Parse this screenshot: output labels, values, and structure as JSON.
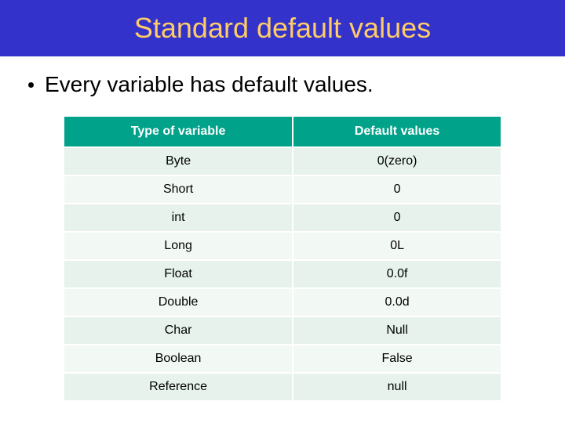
{
  "title": "Standard default values",
  "bullet": "Every variable has default values.",
  "table": {
    "headers": [
      "Type of variable",
      "Default values"
    ],
    "rows": [
      {
        "type": "Byte",
        "value": "0(zero)"
      },
      {
        "type": "Short",
        "value": "0"
      },
      {
        "type": "int",
        "value": "0"
      },
      {
        "type": "Long",
        "value": "0L"
      },
      {
        "type": "Float",
        "value": "0.0f"
      },
      {
        "type": "Double",
        "value": "0.0d"
      },
      {
        "type": "Char",
        "value": "Null"
      },
      {
        "type": "Boolean",
        "value": "False"
      },
      {
        "type": "Reference",
        "value": "null"
      }
    ]
  }
}
